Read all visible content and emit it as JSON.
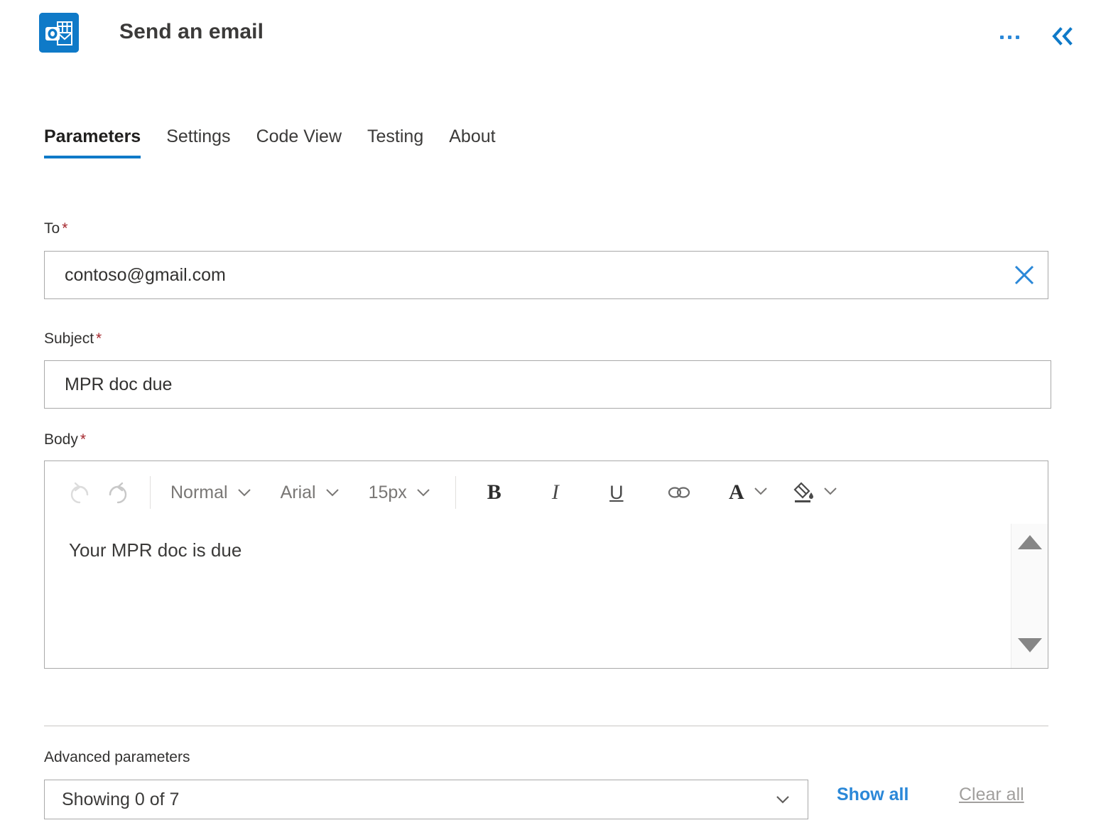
{
  "header": {
    "title": "Send an email",
    "app_icon": "outlook-icon",
    "more_label": "…",
    "collapse_label": "«",
    "accent_color": "#0f7ac8"
  },
  "tabs": [
    {
      "label": "Parameters",
      "active": true
    },
    {
      "label": "Settings",
      "active": false
    },
    {
      "label": "Code View",
      "active": false
    },
    {
      "label": "Testing",
      "active": false
    },
    {
      "label": "About",
      "active": false
    }
  ],
  "fields": {
    "to": {
      "label": "To",
      "required_marker": "*",
      "value": "contoso@gmail.com",
      "clear_icon": "close-icon"
    },
    "subject": {
      "label": "Subject",
      "required_marker": "*",
      "value": "MPR doc due"
    },
    "body": {
      "label": "Body",
      "required_marker": "*",
      "value": "Your MPR doc is due"
    }
  },
  "editor_toolbar": {
    "undo": {
      "icon": "undo-icon",
      "label": "Undo",
      "disabled": true
    },
    "redo": {
      "icon": "redo-icon",
      "label": "Redo",
      "disabled": false
    },
    "style": {
      "value": "Normal",
      "chevron": "chevron-down-icon"
    },
    "font": {
      "value": "Arial",
      "chevron": "chevron-down-icon"
    },
    "size": {
      "value": "15px",
      "chevron": "chevron-down-icon"
    },
    "bold": {
      "label": "B",
      "icon": "bold-icon"
    },
    "italic": {
      "label": "I",
      "icon": "italic-icon"
    },
    "underline": {
      "label": "U",
      "icon": "underline-icon"
    },
    "link": {
      "icon": "link-icon"
    },
    "font_color": {
      "label": "A",
      "icon": "font-color-icon",
      "chevron": "chevron-down-icon"
    },
    "highlight": {
      "icon": "highlight-icon",
      "chevron": "chevron-down-icon"
    },
    "scroll_up": "scroll-up-arrow",
    "scroll_down": "scroll-down-arrow"
  },
  "advanced": {
    "label": "Advanced parameters",
    "select_value": "Showing 0 of 7",
    "select_chevron": "chevron-down-icon",
    "show_all": "Show all",
    "clear_all": "Clear all"
  },
  "colors": {
    "accent": "#0f7ac8",
    "link": "#2b88d8",
    "required": "#a4262c",
    "border": "#a9a9a9",
    "muted": "#a19f9d"
  }
}
